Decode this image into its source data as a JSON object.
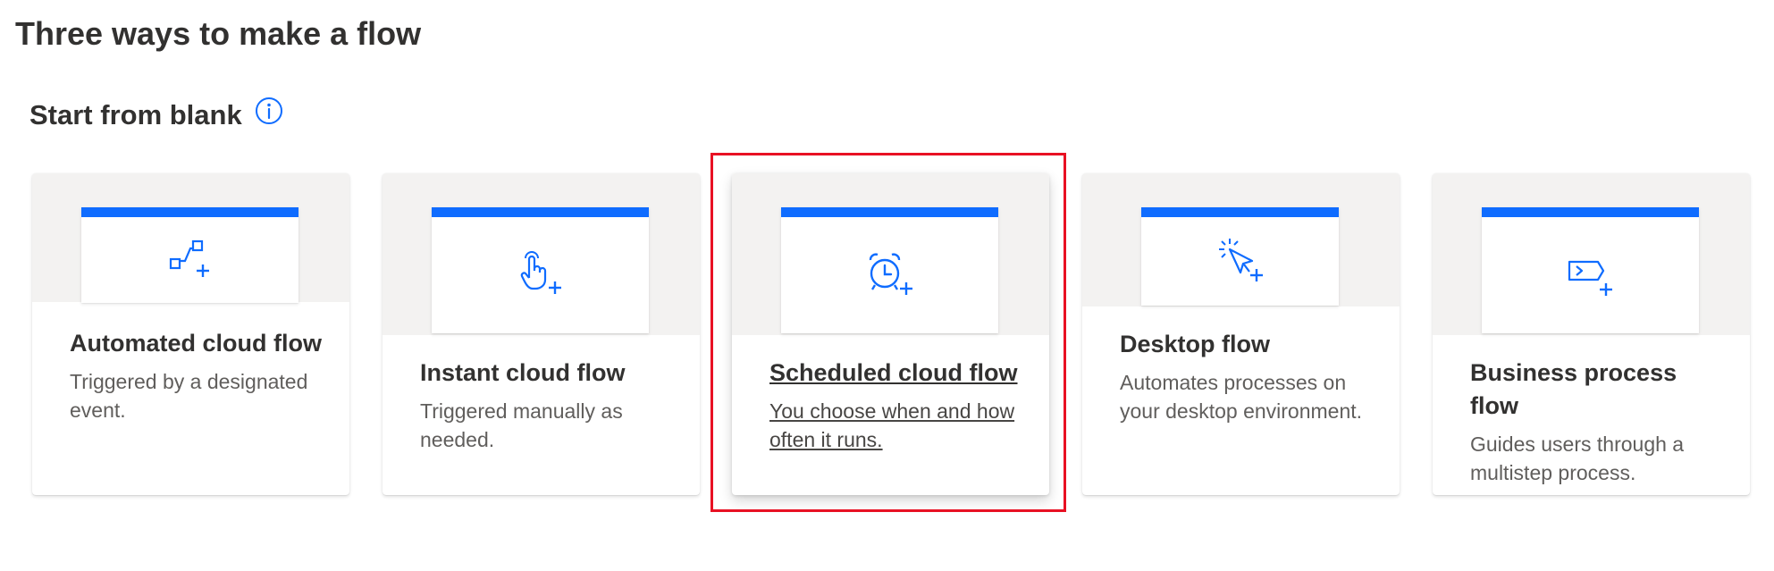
{
  "page": {
    "title": "Three ways to make a flow"
  },
  "section": {
    "title": "Start from blank",
    "info_icon": "info-icon"
  },
  "colors": {
    "accent": "#0f6cff",
    "highlight": "#e81123",
    "card_top_bg": "#f3f2f1"
  },
  "cards": [
    {
      "title": "Automated cloud flow",
      "description": "Triggered by a designated event.",
      "icon": "connected-nodes-icon"
    },
    {
      "title": "Instant cloud flow",
      "description": "Triggered manually as needed.",
      "icon": "touch-hand-icon"
    },
    {
      "title": "Scheduled cloud flow",
      "description": "You choose when and how often it runs.",
      "icon": "alarm-clock-icon",
      "highlighted": true
    },
    {
      "title": "Desktop flow",
      "description": "Automates processes on your desktop environment.",
      "icon": "cursor-click-icon"
    },
    {
      "title": "Business process flow",
      "description": "Guides users through a multistep process.",
      "icon": "process-arrow-icon"
    }
  ]
}
